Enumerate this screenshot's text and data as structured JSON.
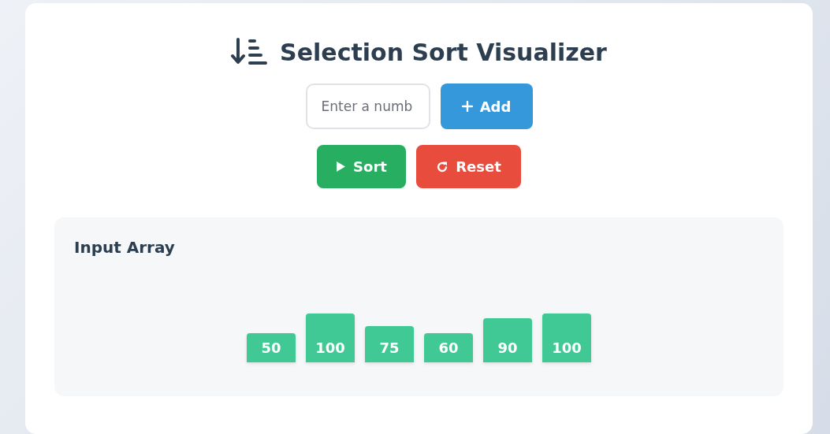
{
  "title": "Selection Sort Visualizer",
  "input": {
    "placeholder": "Enter a numb"
  },
  "buttons": [
    {
      "kind": "add",
      "label": "Add"
    },
    {
      "kind": "sort",
      "label": "Sort"
    },
    {
      "kind": "reset",
      "label": "Reset"
    }
  ],
  "panel": {
    "title": "Input Array",
    "bars": [
      {
        "value": "50"
      },
      {
        "value": "100"
      },
      {
        "value": "75"
      },
      {
        "value": "60"
      },
      {
        "value": "90"
      },
      {
        "value": "100"
      }
    ]
  }
}
